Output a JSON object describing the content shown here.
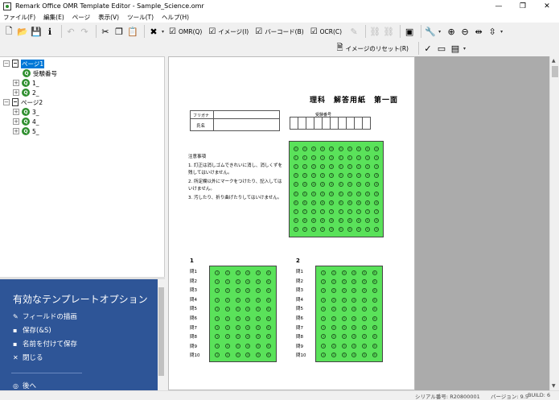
{
  "window": {
    "title": "Remark Office OMR Template Editor - Sample_Science.omr",
    "controls": [
      "—",
      "❐",
      "✕"
    ]
  },
  "menu": [
    "ファイル(F)",
    "編集(E)",
    "ページ",
    "表示(V)",
    "ツール(T)",
    "ヘルプ(H)"
  ],
  "toolbar": {
    "omr_label": "OMR(Q)",
    "image_label": "イメージ(I)",
    "barcode_label": "バーコード(B)",
    "ocr_label": "OCR(C)",
    "reset_image_label": "イメージのリセット(R)"
  },
  "tree": {
    "page1": "ページ1",
    "exam_number": "受験番号",
    "q1": "1_",
    "q2": "2_",
    "page2": "ページ2",
    "q3": "3_",
    "q4": "4_",
    "q5": "5_"
  },
  "task_pane": {
    "title": "有効なテンプレートオプション",
    "items": [
      "フィールドの描画",
      "保存(&S)",
      "名前を付けて保存",
      "閉じる"
    ],
    "back": "後へ"
  },
  "document": {
    "sheet_title": "理科　解答用紙　第一面",
    "furigana": "フリガナ",
    "name": "氏名",
    "exam_number_label": "受験番号",
    "notes_title": "注意事項",
    "notes": [
      "1. 訂正は消しゴムできれいに消し、消しくずを残してはいけません。",
      "2. 所定欄以外にマークをつけたり、記入してはいけません。",
      "3. 汚したり、折り曲げたりしてはいけません。"
    ],
    "section1": "1",
    "section2": "2",
    "question_labels": [
      "問1",
      "問2",
      "問3",
      "問4",
      "問5",
      "問6",
      "問7",
      "問8",
      "問9",
      "問10"
    ],
    "bubble_digits": [
      "0",
      "1",
      "2",
      "3",
      "4",
      "5",
      "6",
      "7",
      "8",
      "9"
    ],
    "choice_bubbles": [
      "1",
      "2",
      "3",
      "4",
      "5",
      "6"
    ]
  },
  "status": {
    "serial": "シリアル番号: R20800001",
    "version": "バージョン: 9.5",
    "build": "BUILD: 6"
  },
  "colors": {
    "omr_fill": "#5ae25a",
    "task_pane_bg": "#2e5597",
    "selection": "#0078d7",
    "gray_area": "#ababab"
  }
}
